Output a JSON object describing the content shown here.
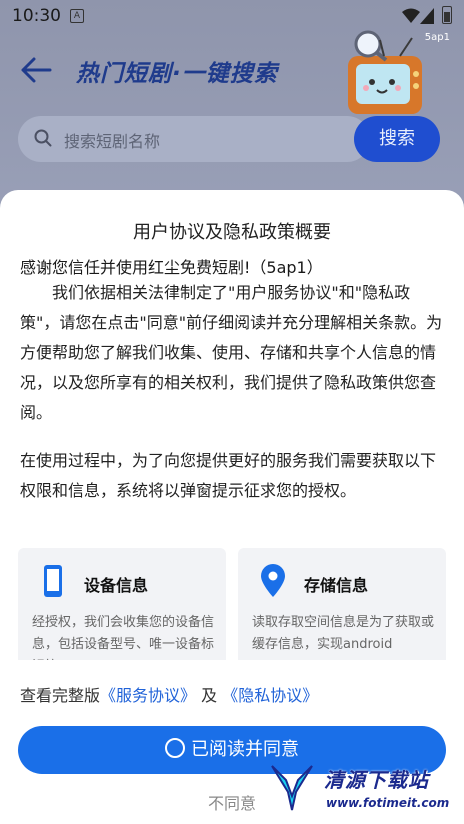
{
  "status_bar": {
    "time": "10:30",
    "badge": "A",
    "corner_tag": "5ap1"
  },
  "header": {
    "title": "热门短剧·一键搜索",
    "back_icon": "arrow-left-icon"
  },
  "search": {
    "placeholder": "搜索短剧名称",
    "button_label": "搜索"
  },
  "dialog": {
    "title": "用户协议及隐私政策概要",
    "thanks": "感谢您信任并使用红尘免费短剧!（5ap1）",
    "paragraph1": "我们依据相关法律制定了\"用户服务协议\"和\"隐私政策\"，请您在点击\"同意\"前仔细阅读并充分理解相关条款。为方便帮助您了解我们收集、使用、存储和共享个人信息的情况，以及您所享有的相关权利，我们提供了隐私政策供您查阅。",
    "paragraph2": "在使用过程中，为了向您提供更好的服务我们需要获取以下权限和信息，系统将以弹窗提示征求您的授权。",
    "cards": [
      {
        "icon": "phone-icon",
        "title": "设备信息",
        "desc": "经授权，我们会收集您的设备信息，包括设备型号、唯一设备标识符"
      },
      {
        "icon": "location-pin-icon",
        "title": "存储信息",
        "desc": "读取存取空间信息是为了获取或缓存信息，实现android"
      }
    ],
    "links_prefix": "查看完整版",
    "link_service": "《服务协议》",
    "links_and": "及",
    "link_privacy": "《隐私协议》",
    "agree_label": "已阅读并同意",
    "disagree_label": "不同意"
  },
  "watermark": {
    "name": "清源下载站",
    "url": "www.fotimeit.com"
  },
  "colors": {
    "primary": "#1a6fe8",
    "link": "#2163d8",
    "title_blue": "#1f3b8c"
  }
}
